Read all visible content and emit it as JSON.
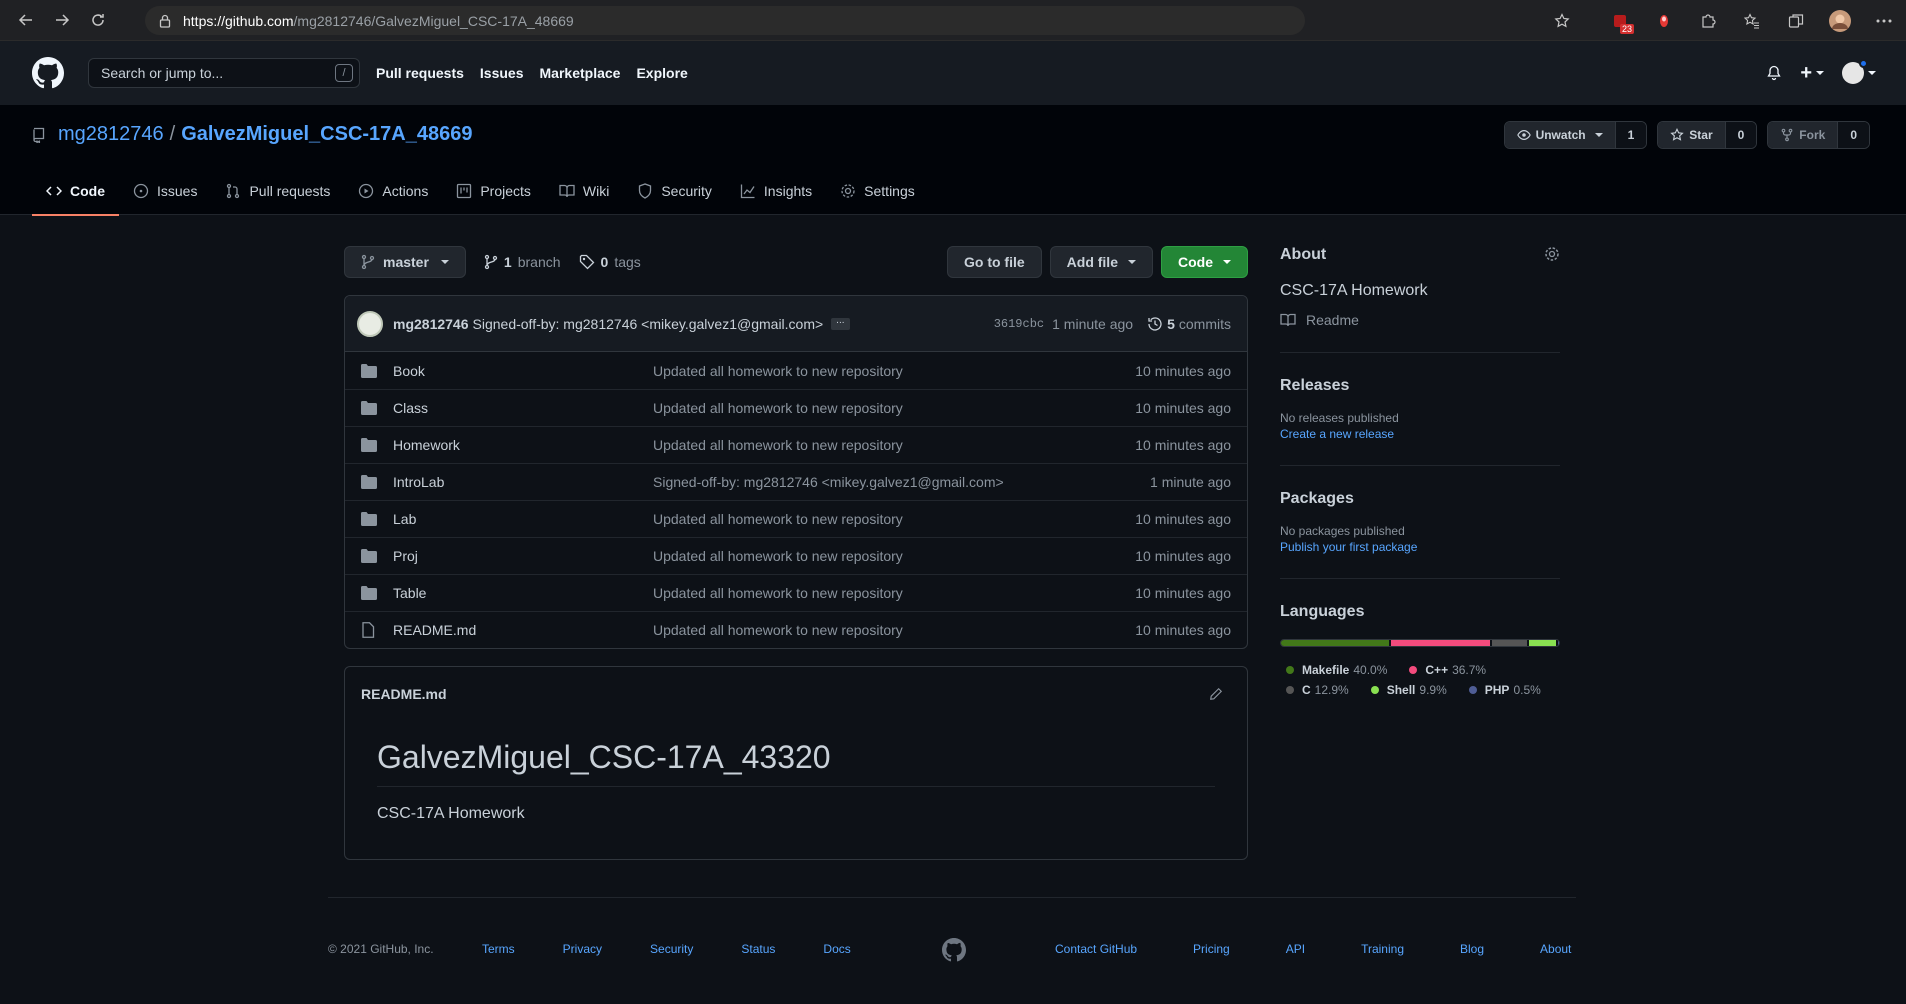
{
  "browser": {
    "url_host": "https://github.com",
    "url_path": "/mg2812746/GalvezMiguel_CSC-17A_48669",
    "ext_badge": "23"
  },
  "header": {
    "search_placeholder": "Search or jump to...",
    "slash": "/",
    "nav": [
      "Pull requests",
      "Issues",
      "Marketplace",
      "Explore"
    ],
    "plus": "+"
  },
  "repo": {
    "owner": "mg2812746",
    "name": "GalvezMiguel_CSC-17A_48669",
    "unwatch_label": "Unwatch",
    "unwatch_count": "1",
    "star_label": "Star",
    "star_count": "0",
    "fork_label": "Fork",
    "fork_count": "0",
    "tabs": [
      "Code",
      "Issues",
      "Pull requests",
      "Actions",
      "Projects",
      "Wiki",
      "Security",
      "Insights",
      "Settings"
    ]
  },
  "toolbar": {
    "branch": "master",
    "branch_count": "1",
    "branch_label": "branch",
    "tag_count": "0",
    "tag_label": "tags",
    "go_to_file": "Go to file",
    "add_file": "Add file",
    "code": "Code"
  },
  "commit": {
    "author": "mg2812746",
    "message": "Signed-off-by: mg2812746 <mikey.galvez1@gmail.com>",
    "dots": "...",
    "sha": "3619cbc",
    "age": "1 minute ago",
    "commit_count": "5",
    "commit_label": "commits"
  },
  "files": [
    {
      "name": "Book",
      "type": "dir",
      "message": "Updated all homework to new repository",
      "age": "10 minutes ago"
    },
    {
      "name": "Class",
      "type": "dir",
      "message": "Updated all homework to new repository",
      "age": "10 minutes ago"
    },
    {
      "name": "Homework",
      "type": "dir",
      "message": "Updated all homework to new repository",
      "age": "10 minutes ago"
    },
    {
      "name": "IntroLab",
      "type": "dir",
      "message": "Signed-off-by: mg2812746 <mikey.galvez1@gmail.com>",
      "age": "1 minute ago"
    },
    {
      "name": "Lab",
      "type": "dir",
      "message": "Updated all homework to new repository",
      "age": "10 minutes ago"
    },
    {
      "name": "Proj",
      "type": "dir",
      "message": "Updated all homework to new repository",
      "age": "10 minutes ago"
    },
    {
      "name": "Table",
      "type": "dir",
      "message": "Updated all homework to new repository",
      "age": "10 minutes ago"
    },
    {
      "name": "README.md",
      "type": "file",
      "message": "Updated all homework to new repository",
      "age": "10 minutes ago"
    }
  ],
  "readme": {
    "filename": "README.md",
    "title": "GalvezMiguel_CSC-17A_43320",
    "body": "CSC-17A Homework"
  },
  "sidebar": {
    "about_title": "About",
    "about_desc": "CSC-17A Homework",
    "readme_link": "Readme",
    "releases_title": "Releases",
    "releases_none": "No releases published",
    "releases_link": "Create a new release",
    "packages_title": "Packages",
    "packages_none": "No packages published",
    "packages_link": "Publish your first package",
    "languages_title": "Languages",
    "languages": [
      {
        "name": "Makefile",
        "percent": "40.0%",
        "value": 40.0,
        "color": "#427819"
      },
      {
        "name": "C++",
        "percent": "36.7%",
        "value": 36.7,
        "color": "#f34b7d"
      },
      {
        "name": "C",
        "percent": "12.9%",
        "value": 12.9,
        "color": "#555555"
      },
      {
        "name": "Shell",
        "percent": "9.9%",
        "value": 9.9,
        "color": "#89e051"
      },
      {
        "name": "PHP",
        "percent": "0.5%",
        "value": 0.5,
        "color": "#4F5D95"
      }
    ]
  },
  "footer": {
    "copyright": "© 2021 GitHub, Inc.",
    "left_links": [
      "Terms",
      "Privacy",
      "Security",
      "Status",
      "Docs"
    ],
    "right_links": [
      "Contact GitHub",
      "Pricing",
      "API",
      "Training",
      "Blog",
      "About"
    ]
  }
}
